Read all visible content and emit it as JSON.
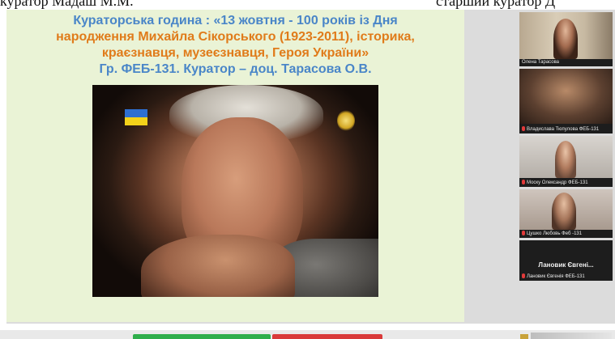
{
  "doc_header": {
    "left_text": "куратор Мадаш М.М.",
    "right_text": "старший куратор Д"
  },
  "slide": {
    "title_line1": "Кураторська година : «13 жовтня - 100 років із Дня",
    "title_line2": "народження Михайла Сікорського (1923-2011), історика,",
    "title_line3": "краєзнавця, музеєзнавця, Героя України»",
    "subtitle": "Гр. ФЕБ-131. Куратор – доц. Тарасова О.В.",
    "colors": {
      "background": "#eaf3d6",
      "title_blue": "#4a86c8",
      "title_orange": "#e07b1a"
    }
  },
  "participants": [
    {
      "name": "Олена Тарасова",
      "muted": false
    },
    {
      "name": "Владислава Тюпулова ФЕБ-131",
      "muted": true
    },
    {
      "name": "Моску Олександр ФЕБ-131",
      "muted": true
    },
    {
      "name": "Цушко Любовь Феб -131",
      "muted": true
    },
    {
      "name": "Лановик Євгенія ФЕБ-131",
      "muted": true,
      "display_name": "Лановик Євгені..."
    }
  ],
  "bottom_bar": {
    "green_color": "#2fae4b",
    "red_color": "#d93a3a"
  }
}
